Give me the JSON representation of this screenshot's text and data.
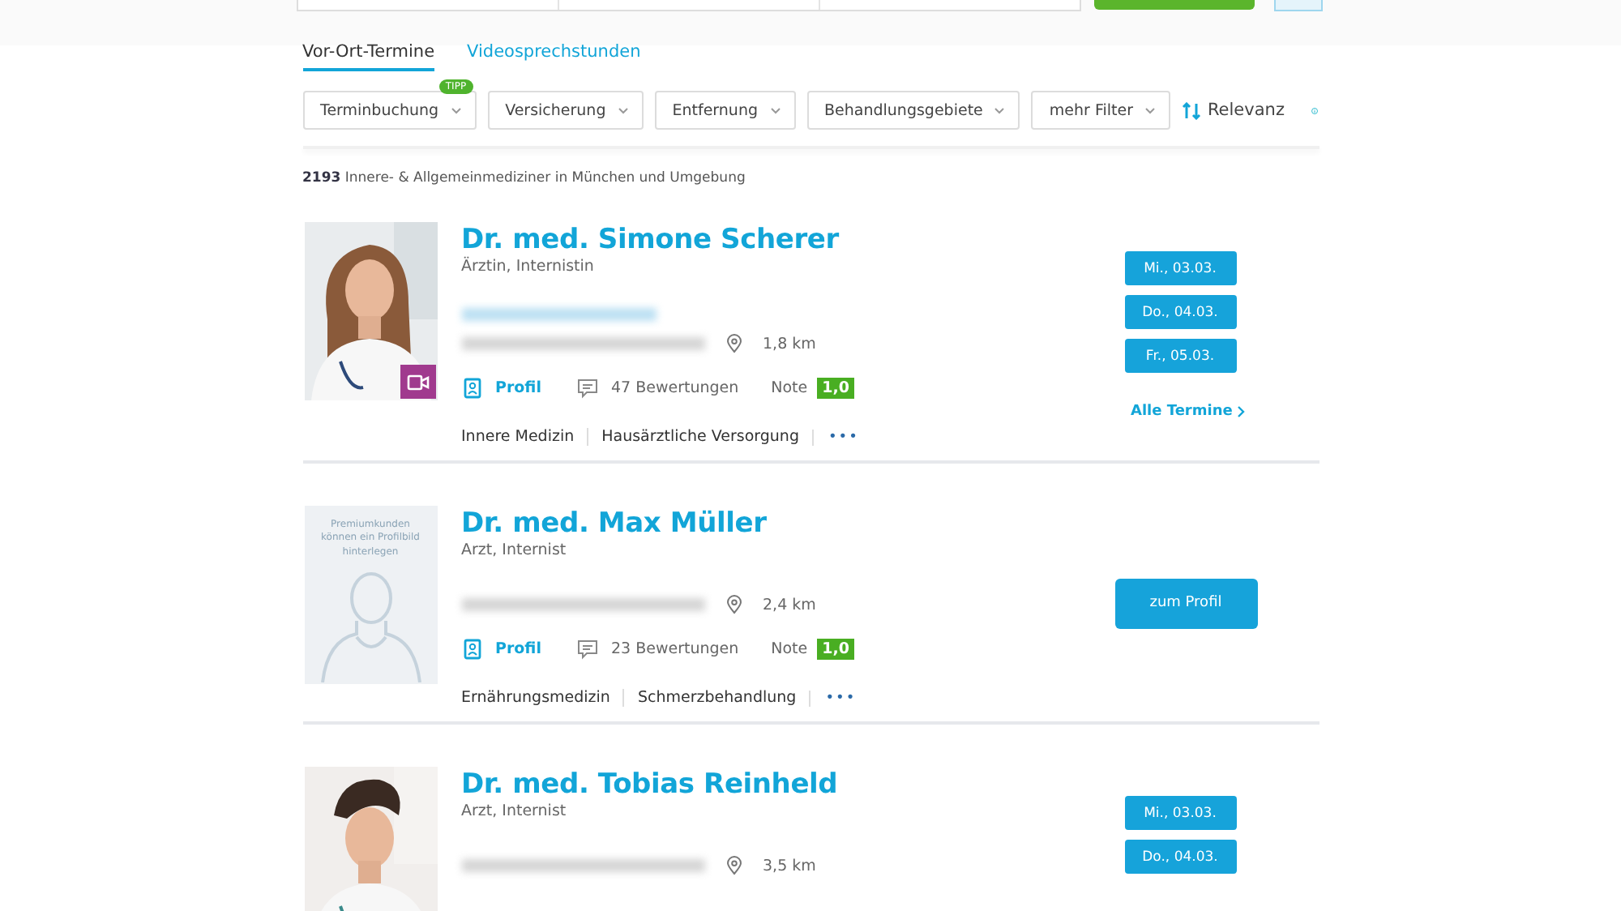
{
  "tabs": [
    {
      "label": "Vor-Ort-Termine",
      "selected": true
    },
    {
      "label": "Videosprechstunden",
      "selected": false
    }
  ],
  "filters": [
    {
      "label": "Terminbuchung",
      "badge": "TIPP"
    },
    {
      "label": "Versicherung"
    },
    {
      "label": "Entfernung"
    },
    {
      "label": "Behandlungsgebiete"
    },
    {
      "label": "mehr Filter"
    }
  ],
  "sort": {
    "label": "Relevanz"
  },
  "result_count": "**2193** Innere- & Allgemeinmediziner in München und Umgebung",
  "doctors": [
    {
      "kind": "dates",
      "name": "Dr. med. Simone Scherer",
      "title": "Ärztin, Internistin",
      "photo": {
        "kind": "picture"
      },
      "video": true,
      "practice_line": true,
      "distance": "1,8 km",
      "profile_link": "Profil",
      "reviews": "47 Bewertungen",
      "grade_label": "Note",
      "grade": "1,0",
      "tags": [
        "Innere Medizin",
        "Hausärztliche Versorgung"
      ],
      "more": "•••",
      "dates": [
        "Mi., 03.03.",
        "Do., 04.03.",
        "Fr., 05.03."
      ],
      "all_link": "Alle Termine"
    },
    {
      "kind": "profile_button",
      "name": "Dr. med. Max Müller",
      "title": "Arzt, Internist",
      "photo": {
        "kind": "placeholder",
        "text": "Premiumkunden können ein Profilbild hinterlegen"
      },
      "video": false,
      "practice_line": false,
      "distance": "2,4 km",
      "profile_link": "Profil",
      "reviews": "23 Bewertungen",
      "grade_label": "Note",
      "grade": "1,0",
      "tags": [
        "Ernährungsmedizin",
        "Schmerzbehandlung"
      ],
      "more": "•••",
      "button": "zum Profil"
    },
    {
      "kind": "dates",
      "name": "Dr. med. Tobias Reinheld",
      "title": "Arzt, Internist",
      "photo": {
        "kind": "picture"
      },
      "video": false,
      "practice_line": false,
      "distance": "3,5 km",
      "dates": [
        "Mi., 03.03.",
        "Do., 04.03."
      ]
    }
  ]
}
